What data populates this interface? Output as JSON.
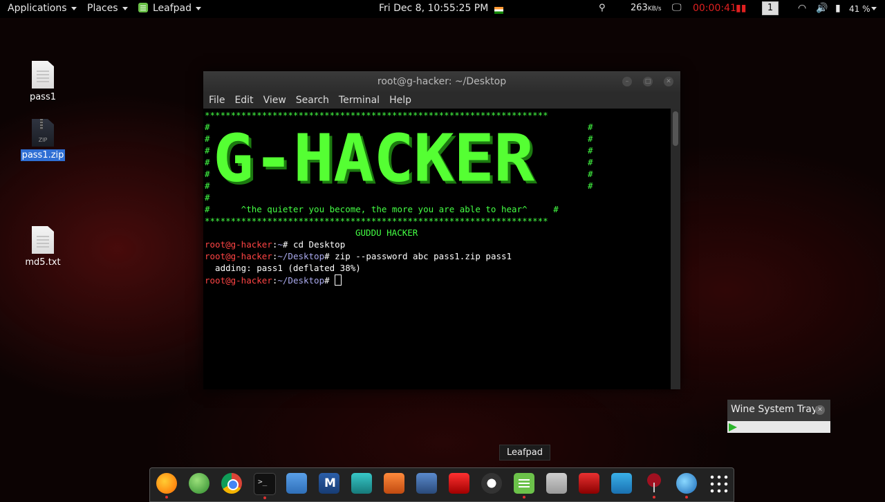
{
  "top_panel": {
    "applications": "Applications",
    "places": "Places",
    "leafpad": "Leafpad",
    "clock": "Fri Dec  8, 10:55:25 PM",
    "net_speed": "263",
    "net_unit": "KB/s",
    "recording_time": "00:00:41",
    "workspace": "1",
    "battery": "41 %"
  },
  "desktop_icons": [
    {
      "label": "pass1",
      "type": "file"
    },
    {
      "label": "pass1.zip",
      "type": "zip",
      "selected": true,
      "zip_tag": "ZIP"
    },
    {
      "label": "md5.txt",
      "type": "file"
    }
  ],
  "terminal": {
    "title": "root@g-hacker: ~/Desktop",
    "menu": [
      "File",
      "Edit",
      "View",
      "Search",
      "Terminal",
      "Help"
    ],
    "border_line": "******************************************************************",
    "hash": "#",
    "banner": "G-HACKER",
    "tagline": "#      ^the quieter you become, the more you are able to hear^     #",
    "author": "GUDDU HACKER",
    "lines": [
      {
        "user": "root@g-hacker",
        "sep": ":",
        "path": "~",
        "prompt": "# ",
        "cmd": "cd Desktop"
      },
      {
        "user": "root@g-hacker",
        "sep": ":",
        "path": "~/Desktop",
        "prompt": "# ",
        "cmd": "zip --password abc pass1.zip pass1"
      },
      {
        "output": "  adding: pass1 (deflated 38%)"
      },
      {
        "user": "root@g-hacker",
        "sep": ":",
        "path": "~/Desktop",
        "prompt": "# ",
        "cmd": ""
      }
    ]
  },
  "wine_tray": {
    "title": "Wine System Tray"
  },
  "tooltip": "Leafpad",
  "dock": [
    "firefox-icon",
    "globe-icon",
    "chrome-icon",
    "terminal-icon",
    "files-icon",
    "metasploit-icon",
    "armitage-icon",
    "burpsuite-icon",
    "beef-icon",
    "faraday-icon",
    "maltego-icon",
    "leafpad-icon",
    "calculator-icon",
    "redteam-icon",
    "wireshark-icon",
    "wine-icon",
    "ie-icon",
    "show-apps-icon"
  ],
  "colors": {
    "prompt_user": "#ff4444",
    "prompt_path": "#aaaaee",
    "banner": "#55ff33",
    "selection": "#2f6fd4"
  }
}
